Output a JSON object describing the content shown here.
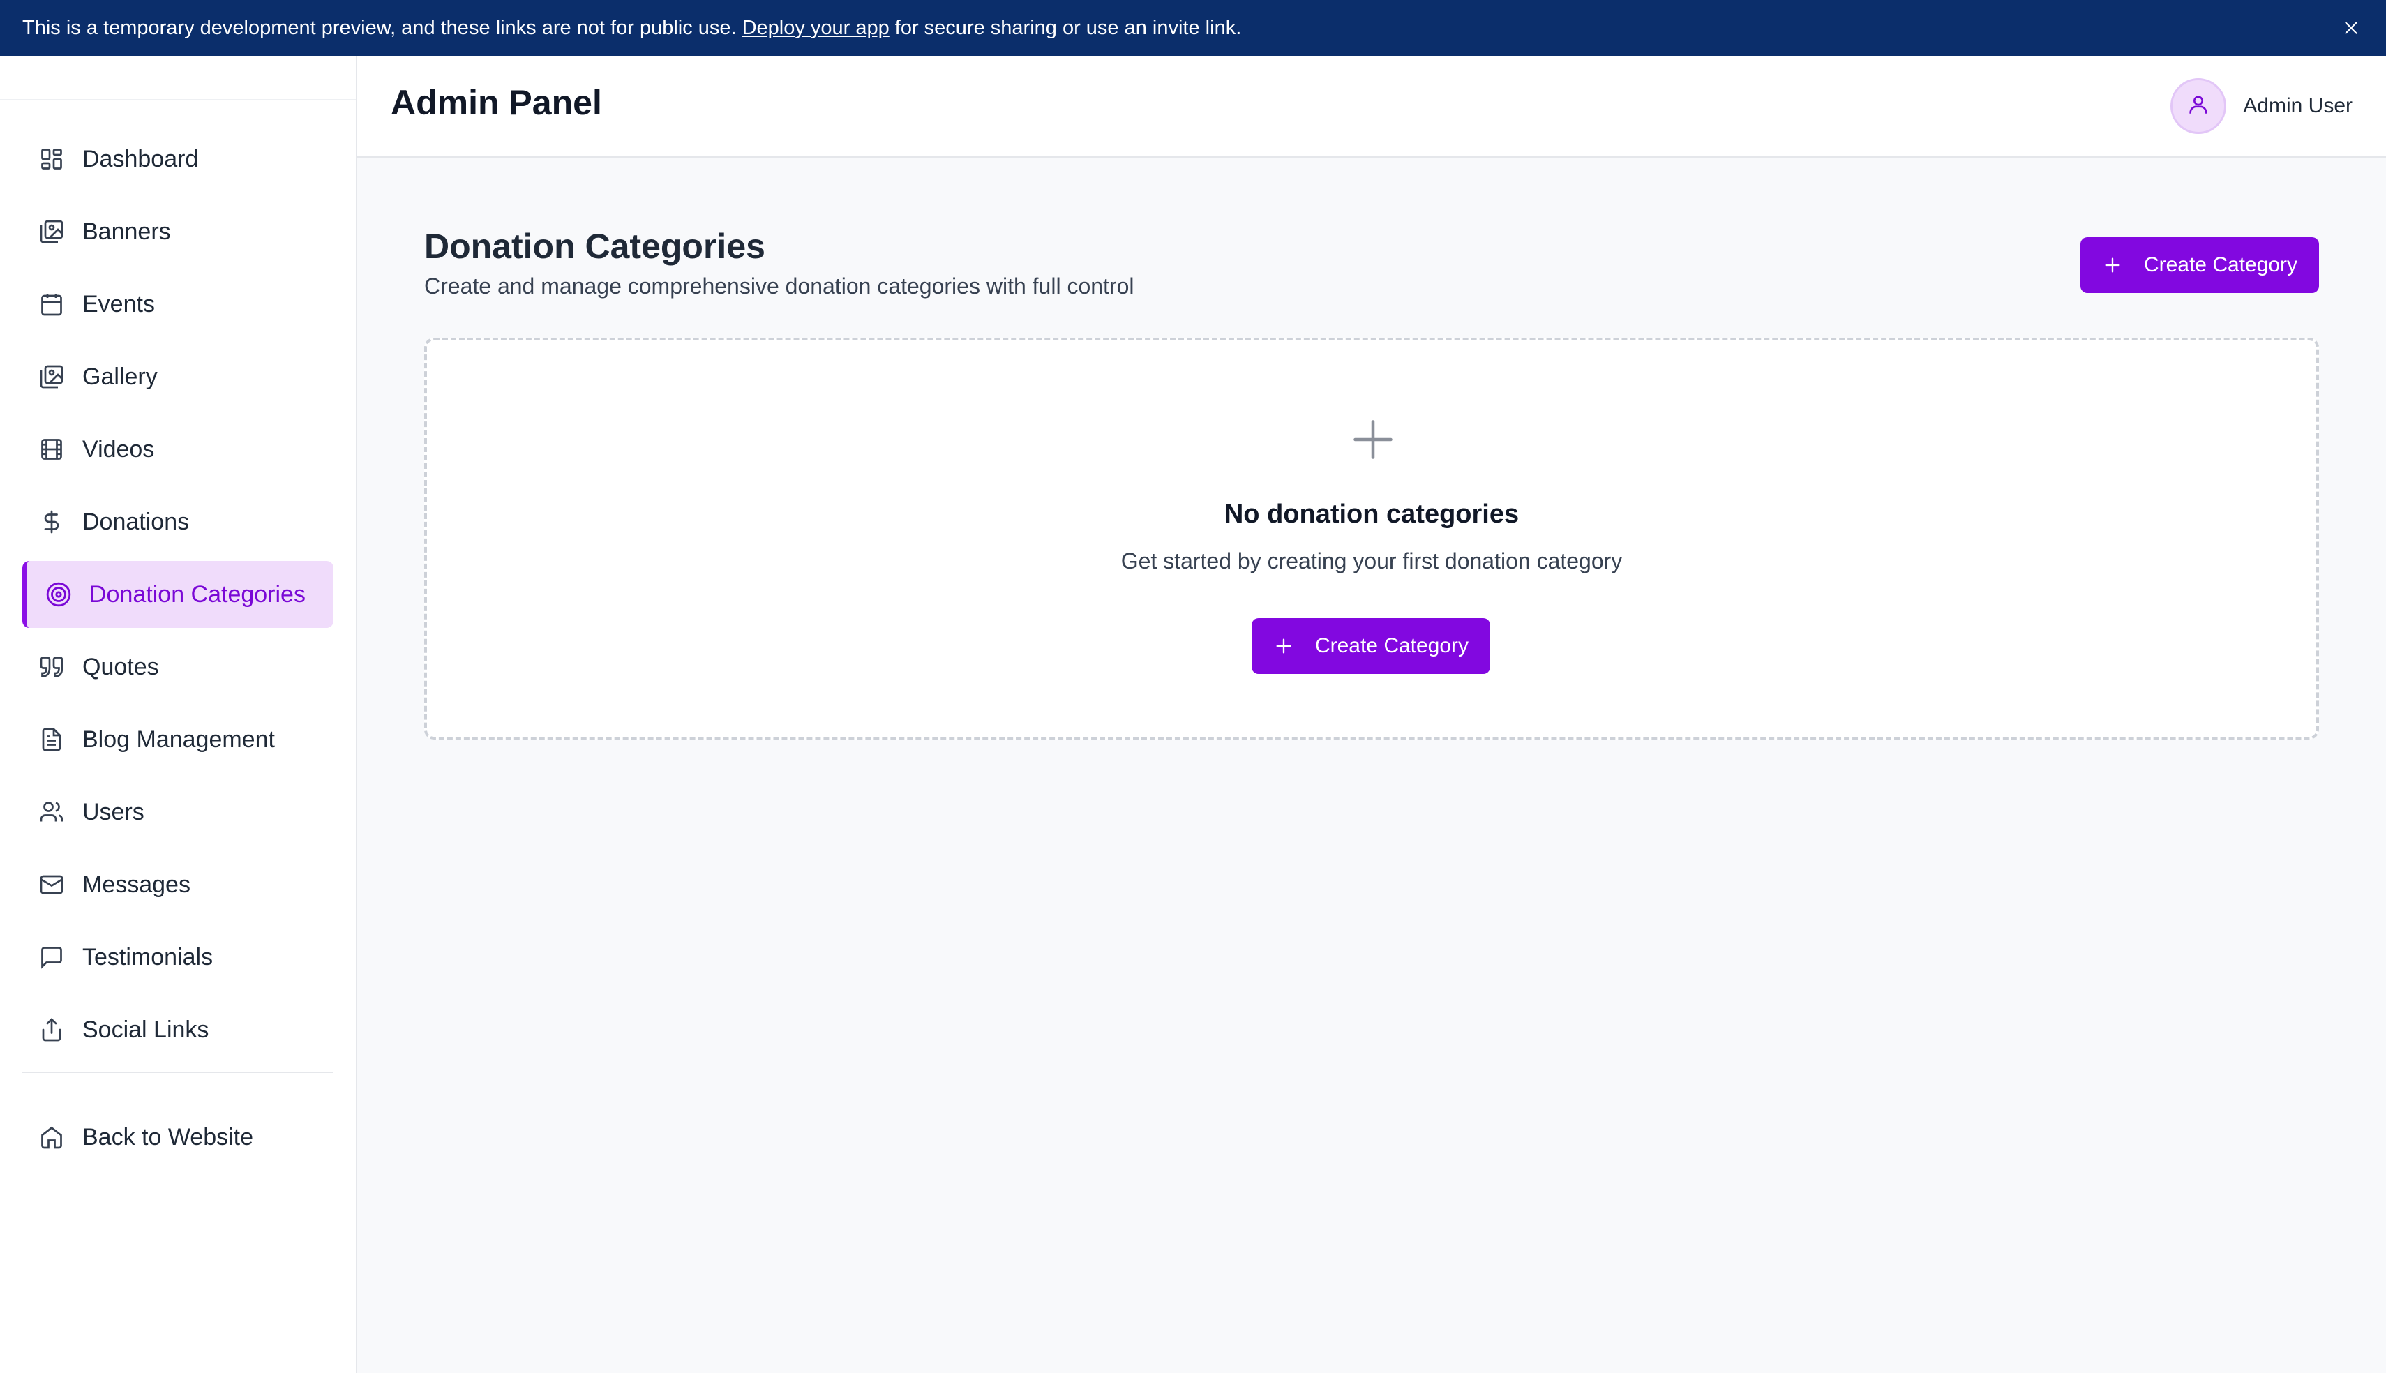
{
  "banner": {
    "text_before": "This is a temporary development preview, and these links are not for public use.",
    "link": "Deploy your app",
    "text_after": "for secure sharing or use an invite link."
  },
  "header": {
    "title": "Admin Panel",
    "user_name": "Admin User"
  },
  "sidebar": {
    "items": [
      {
        "label": "Dashboard",
        "icon": "dashboard-icon"
      },
      {
        "label": "Banners",
        "icon": "image-icon"
      },
      {
        "label": "Events",
        "icon": "calendar-icon"
      },
      {
        "label": "Gallery",
        "icon": "gallery-icon"
      },
      {
        "label": "Videos",
        "icon": "film-icon"
      },
      {
        "label": "Donations",
        "icon": "dollar-icon"
      },
      {
        "label": "Donation Categories",
        "icon": "target-icon",
        "active": true
      },
      {
        "label": "Quotes",
        "icon": "quote-icon"
      },
      {
        "label": "Blog Management",
        "icon": "document-icon"
      },
      {
        "label": "Users",
        "icon": "users-icon"
      },
      {
        "label": "Messages",
        "icon": "mail-icon"
      },
      {
        "label": "Testimonials",
        "icon": "message-square-icon"
      },
      {
        "label": "Social Links",
        "icon": "share-icon"
      }
    ],
    "back": {
      "label": "Back to Website",
      "icon": "home-icon"
    }
  },
  "main": {
    "title": "Donation Categories",
    "subtitle": "Create and manage comprehensive donation categories with full control",
    "create_button": "Create Category",
    "empty": {
      "title": "No donation categories",
      "subtitle": "Get started by creating your first donation category",
      "button": "Create Category"
    }
  },
  "colors": {
    "accent": "#8208e0",
    "banner": "#0b2e6b",
    "active_bg": "#f0dcfb"
  }
}
